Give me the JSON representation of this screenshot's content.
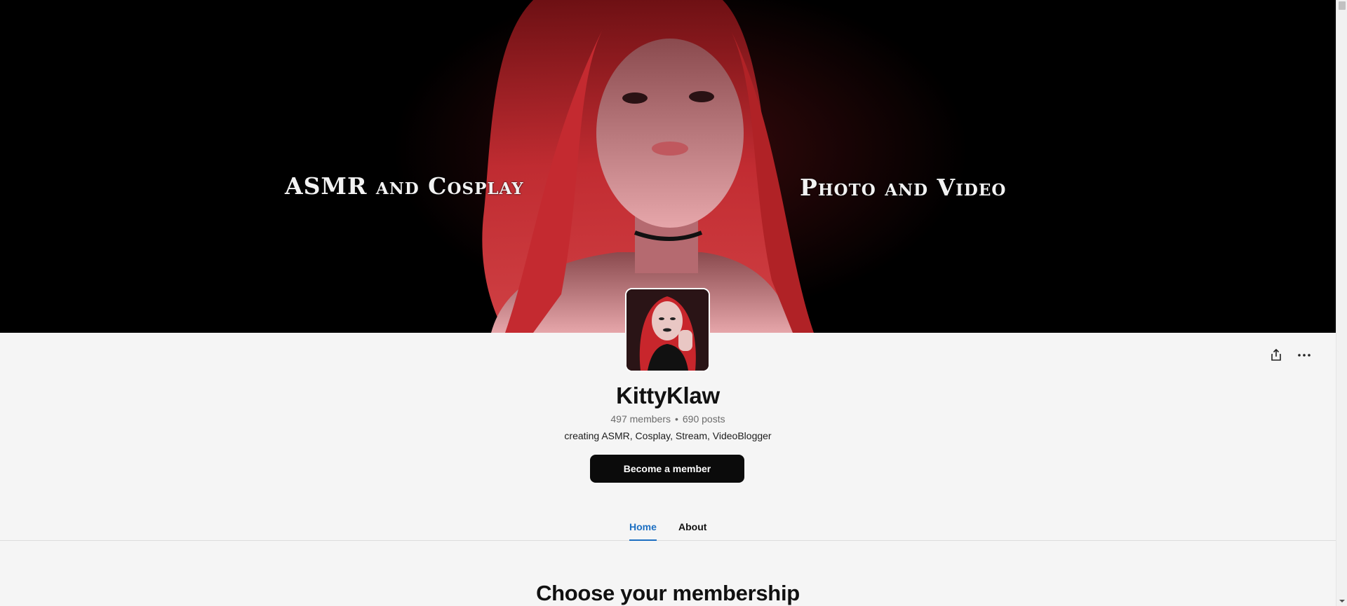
{
  "banner": {
    "left_text": "ASMR and Cosplay",
    "right_text": "Photo and Video"
  },
  "creator": {
    "name": "KittyKlaw",
    "members": "497 members",
    "separator": "•",
    "posts": "690 posts",
    "tagline": "creating ASMR, Cosplay, Stream, VideoBlogger"
  },
  "actions": {
    "share_icon": "share-icon",
    "more_icon": "more-horizontal-icon"
  },
  "cta": {
    "label": "Become a member"
  },
  "tabs": [
    {
      "label": "Home",
      "active": true
    },
    {
      "label": "About",
      "active": false
    }
  ],
  "section": {
    "title": "Choose your membership"
  },
  "colors": {
    "accent": "#1d6fc2",
    "button_bg": "#0b0b0b",
    "page_bg": "#f5f5f5",
    "banner_red": "#e0343a"
  }
}
